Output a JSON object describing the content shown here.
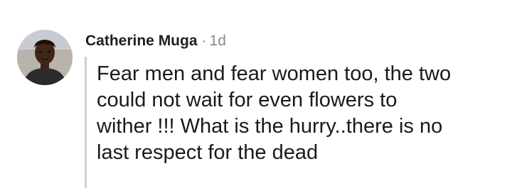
{
  "comment": {
    "author": "Catherine Muga",
    "separator": "·",
    "time": "1d",
    "lines": [
      "Fear men and fear women too, the two",
      "could not wait for even flowers to",
      "wither !!! What is the hurry..there is no",
      "last respect for the dead"
    ]
  }
}
